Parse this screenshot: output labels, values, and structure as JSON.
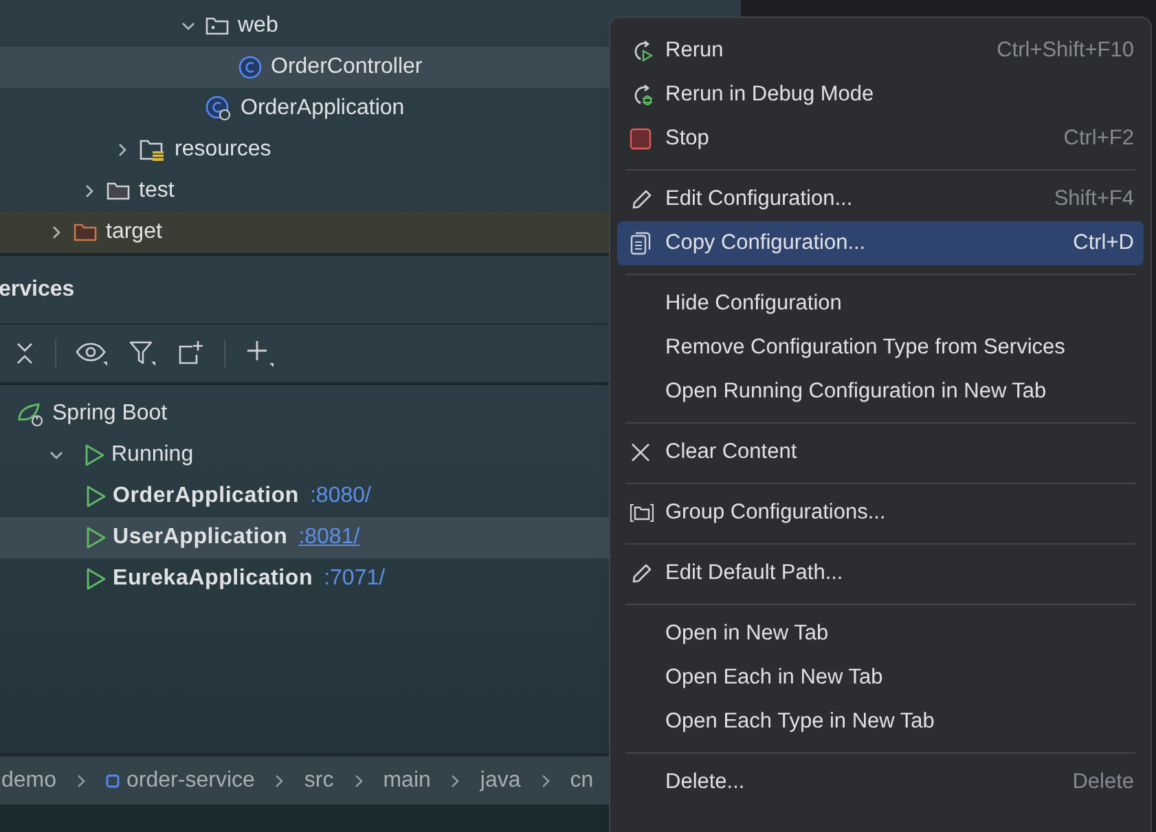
{
  "project_tree": [
    {
      "children": [
        {
          "children": [
            {
              "children": [
                {
                  "children": [
                    {
                      "label": "web",
                      "kind": "package",
                      "expanded": true,
                      "selected": false,
                      "children": [
                        {
                          "label": "OrderController",
                          "kind": "class",
                          "selected": true
                        }
                      ]
                    },
                    {
                      "label": "OrderApplication",
                      "kind": "app_class",
                      "selected": false
                    }
                  ]
                }
              ]
            },
            {
              "label": "resources",
              "kind": "resources_folder",
              "expanded": false,
              "selected": false
            }
          ]
        },
        {
          "label": "test",
          "kind": "folder",
          "expanded": false,
          "selected": false
        }
      ]
    },
    {
      "label": "target",
      "kind": "excluded_folder",
      "expanded": false,
      "selected": false
    }
  ],
  "services": {
    "title": "ervices",
    "tree": [
      {
        "label": "Spring Boot",
        "kind": "spring",
        "children": [
          {
            "label": "Running",
            "kind": "group",
            "expanded": true,
            "children": [
              {
                "label": "OrderApplication",
                "port": ":8080/",
                "selected": false,
                "underlined": false,
                "kind": "app"
              },
              {
                "label": "UserApplication",
                "port": ":8081/",
                "selected": true,
                "underlined": true,
                "kind": "app"
              },
              {
                "label": "EurekaApplication",
                "port": ":7071/",
                "selected": false,
                "underlined": false,
                "kind": "app"
              }
            ]
          }
        ]
      }
    ]
  },
  "breadcrumb": [
    {
      "label": "demo",
      "kind": "plain"
    },
    {
      "label": "order-service",
      "kind": "module"
    },
    {
      "label": "src",
      "kind": "plain"
    },
    {
      "label": "main",
      "kind": "plain"
    },
    {
      "label": "java",
      "kind": "plain"
    },
    {
      "label": "cn",
      "kind": "plain"
    }
  ],
  "context_menu": {
    "groups": [
      [
        {
          "label": "Rerun",
          "kind": "rerun",
          "shortcut": "Ctrl+Shift+F10",
          "selected": false
        },
        {
          "label": "Rerun in Debug Mode",
          "kind": "debug",
          "selected": false
        },
        {
          "label": "Stop",
          "kind": "stop",
          "shortcut": "Ctrl+F2",
          "selected": false
        }
      ],
      [
        {
          "label": "Edit Configuration...",
          "kind": "edit",
          "shortcut": "Shift+F4",
          "selected": false
        },
        {
          "label": "Copy Configuration...",
          "kind": "copy",
          "shortcut": "Ctrl+D",
          "selected": true
        }
      ],
      [
        {
          "label": "Hide Configuration",
          "kind": "plain",
          "selected": false
        },
        {
          "label": "Remove Configuration Type from Services",
          "kind": "plain",
          "selected": false
        },
        {
          "label": "Open Running Configuration in New Tab",
          "kind": "plain",
          "selected": false
        }
      ],
      [
        {
          "label": "Clear Content",
          "kind": "clear",
          "selected": false
        }
      ],
      [
        {
          "label": "Group Configurations...",
          "kind": "group",
          "selected": false
        }
      ],
      [
        {
          "label": "Edit Default Path...",
          "kind": "edit",
          "selected": false
        }
      ],
      [
        {
          "label": "Open in New Tab",
          "kind": "plain",
          "selected": false
        },
        {
          "label": "Open Each in New Tab",
          "kind": "plain",
          "selected": false
        },
        {
          "label": "Open Each Type in New Tab",
          "kind": "plain",
          "selected": false
        }
      ],
      [
        {
          "label": "Delete...",
          "kind": "plain",
          "shortcut": "Delete",
          "selected": false
        }
      ]
    ]
  }
}
